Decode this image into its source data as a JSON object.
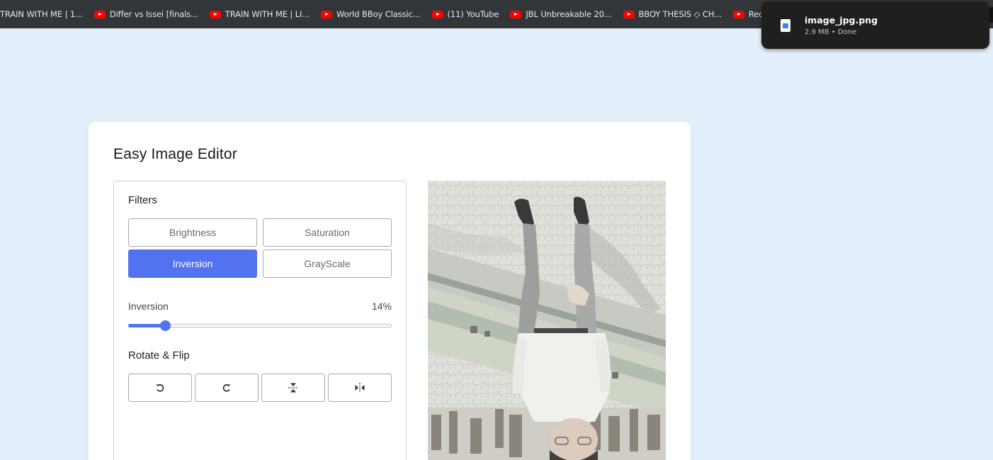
{
  "bookmarks": [
    {
      "label": "TRAIN WITH ME | 1...",
      "icon": false
    },
    {
      "label": "Differ vs Issei [finals...",
      "icon": true
    },
    {
      "label": "TRAIN WITH ME | LI...",
      "icon": true
    },
    {
      "label": "World BBoy Classic...",
      "icon": true
    },
    {
      "label": "(11) YouTube",
      "icon": true
    },
    {
      "label": "JBL Unbreakable 20...",
      "icon": true
    },
    {
      "label": "BBOY THESIS ◇ CH...",
      "icon": true
    },
    {
      "label": "Red Bull BC o",
      "icon": true
    }
  ],
  "download": {
    "filename": "image_jpg.png",
    "status": "2.9 MB • Done"
  },
  "editor": {
    "title": "Easy Image Editor",
    "filters_heading": "Filters",
    "filters": {
      "brightness": "Brightness",
      "saturation": "Saturation",
      "inversion": "Inversion",
      "grayscale": "GrayScale"
    },
    "active_filter": "Inversion",
    "slider": {
      "name": "Inversion",
      "value_text": "14%",
      "value": 0.14
    },
    "rotate_heading": "Rotate & Flip",
    "accent_color": "#5372f0"
  }
}
